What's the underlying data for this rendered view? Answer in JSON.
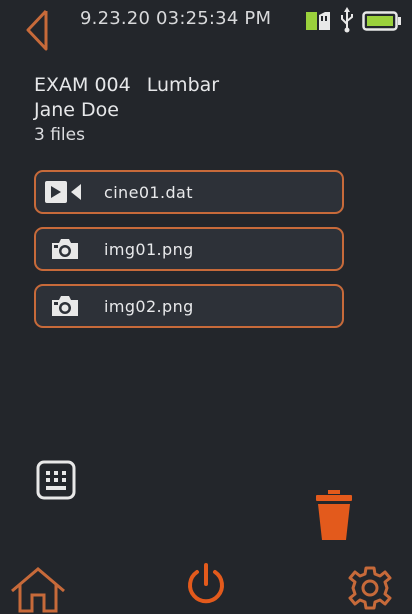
{
  "status_bar": {
    "datetime": "9.23.20  03:25:34 PM",
    "sd_icon": "sd-card-icon",
    "usb_icon": "usb-icon",
    "battery_icon": "battery-full-icon"
  },
  "exam": {
    "id": "EXAM 004",
    "region": "Lumbar",
    "patient": "Jane Doe",
    "files_count": "3 files"
  },
  "files": [
    {
      "name": "cine01.dat",
      "icon": "video-icon"
    },
    {
      "name": "img01.png",
      "icon": "camera-icon"
    },
    {
      "name": "img02.png",
      "icon": "camera-icon"
    }
  ],
  "controls": {
    "back": "back-arrow-icon",
    "keyboard": "keyboard-icon",
    "trash": "trash-icon",
    "home": "home-icon",
    "power": "power-icon",
    "settings": "gear-icon"
  },
  "colors": {
    "accent": "#c76a3a",
    "background": "#23262b",
    "battery": "#9bd13c"
  }
}
